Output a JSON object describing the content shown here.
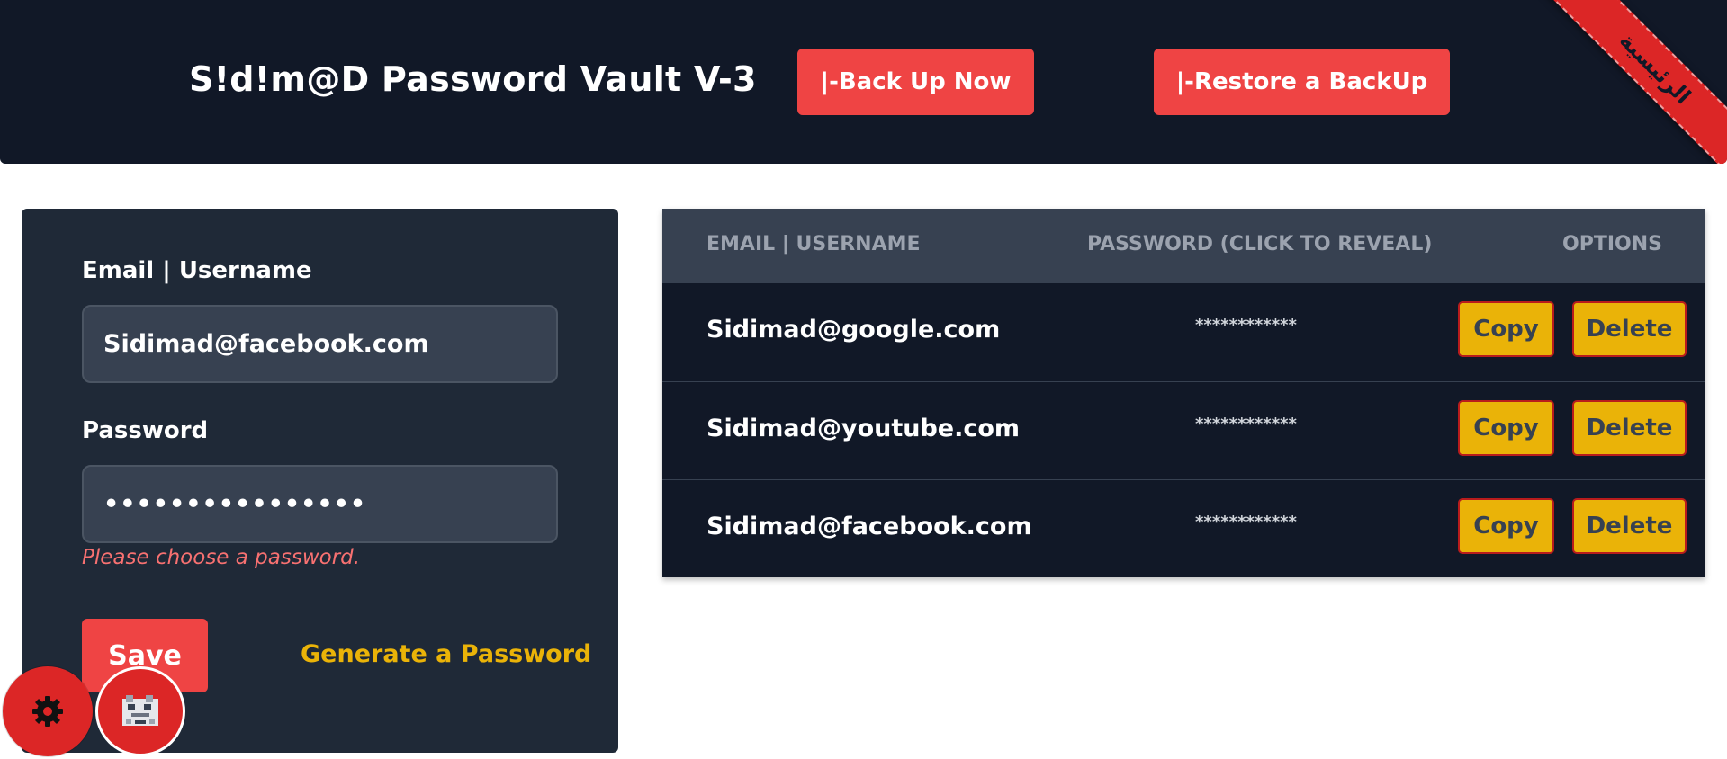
{
  "header": {
    "title": "S!d!m@D Password Vault V-3",
    "backup_label": "|-Back Up Now",
    "restore_label": "|-Restore a BackUp",
    "ribbon_label": "الرئيسية"
  },
  "form": {
    "email_label": "Email | Username",
    "email_value": "Sidimad@facebook.com",
    "password_label": "Password",
    "password_value": "xxxxxxxxxxxxxxxx",
    "error_text": "Please choose a password.",
    "save_label": "Save",
    "generate_label": "Generate a Password"
  },
  "table": {
    "headers": {
      "email": "EMAIL | USERNAME",
      "password": "PASSWORD (CLICK TO REVEAL)",
      "options": "OPTIONS"
    },
    "rows": [
      {
        "email": "Sidimad@google.com",
        "password": "************",
        "copy": "Copy",
        "delete": "Delete"
      },
      {
        "email": "Sidimad@youtube.com",
        "password": "************",
        "copy": "Copy",
        "delete": "Delete"
      },
      {
        "email": "Sidimad@facebook.com",
        "password": "************",
        "copy": "Copy",
        "delete": "Delete"
      }
    ]
  },
  "floating": {
    "settings_icon": "gear-icon",
    "avatar_icon": "avatar-icon"
  },
  "colors": {
    "header_bg": "#111827",
    "card_bg": "#1f2937",
    "accent_red": "#ef4444",
    "accent_yellow": "#eab308",
    "error_text": "#f87171"
  }
}
